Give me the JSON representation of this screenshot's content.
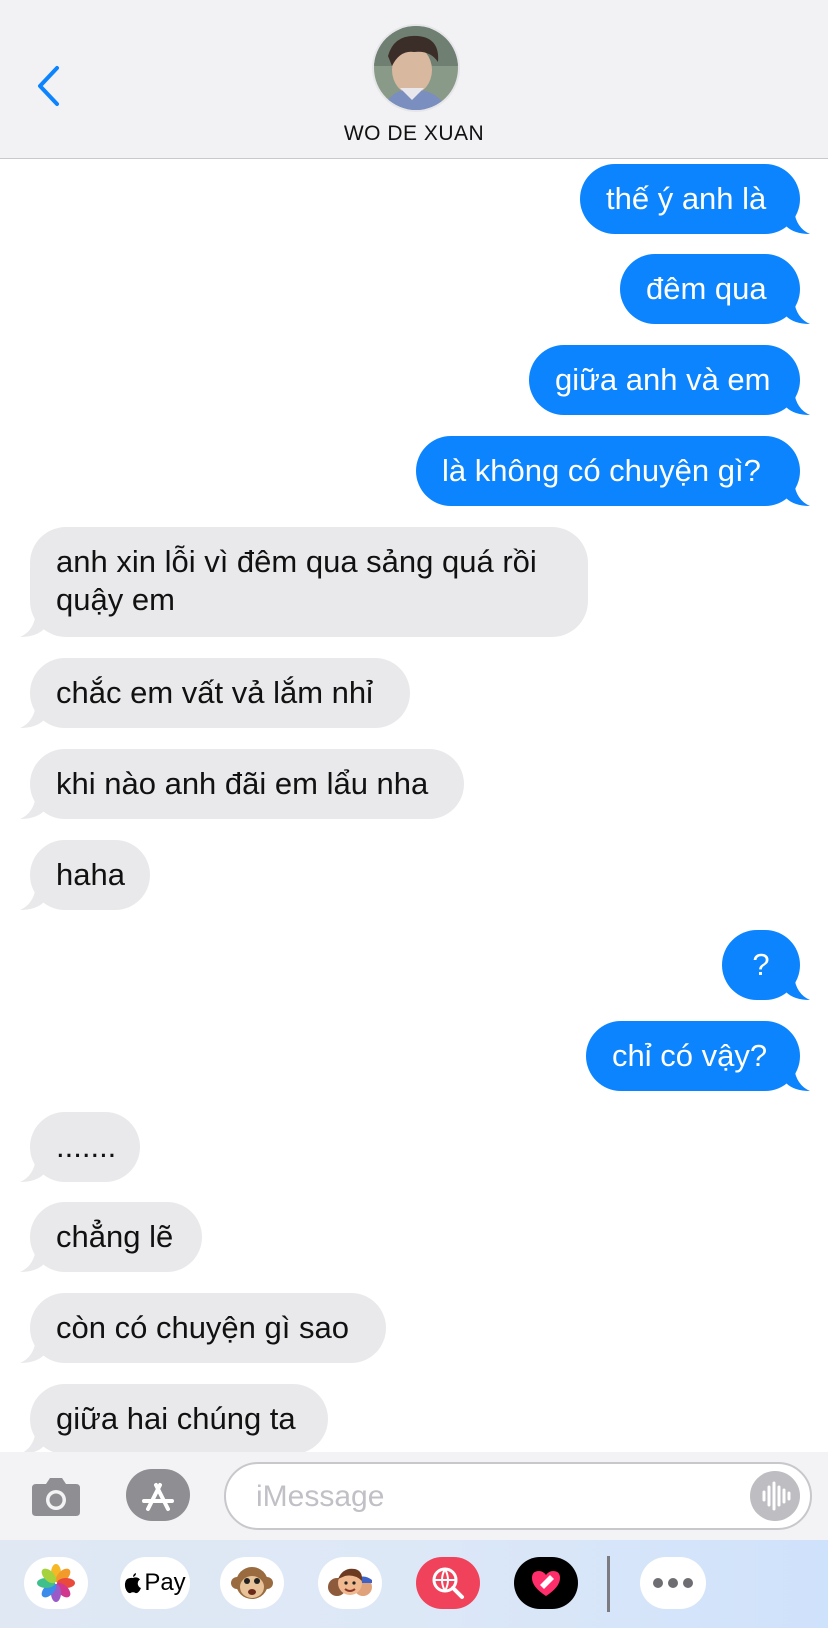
{
  "header": {
    "contact_name": "WO DE XUAN"
  },
  "messages": [
    {
      "direction": "outgoing",
      "text": "thế ý anh là"
    },
    {
      "direction": "outgoing",
      "text": "đêm qua"
    },
    {
      "direction": "outgoing",
      "text": "giữa anh và em"
    },
    {
      "direction": "outgoing",
      "text": "là không có chuyện gì?"
    },
    {
      "direction": "incoming",
      "text": "anh xin lỗi vì đêm qua sảng quá rồi quậy em"
    },
    {
      "direction": "incoming",
      "text": "chắc em vất vả lắm nhỉ"
    },
    {
      "direction": "incoming",
      "text": "khi nào anh đãi em lẩu nha"
    },
    {
      "direction": "incoming",
      "text": "haha"
    },
    {
      "direction": "outgoing",
      "text": "?"
    },
    {
      "direction": "outgoing",
      "text": "chỉ có vậy?"
    },
    {
      "direction": "incoming",
      "text": "......."
    },
    {
      "direction": "incoming",
      "text": "chẳng lẽ"
    },
    {
      "direction": "incoming",
      "text": "còn có chuyện gì sao"
    },
    {
      "direction": "incoming",
      "text": "giữa hai chúng ta"
    }
  ],
  "input_bar": {
    "placeholder": "iMessage",
    "value": ""
  },
  "app_drawer": {
    "apple_pay_label": "Pay",
    "apps": [
      "photos-icon",
      "apple-pay-icon",
      "monkey-animoji-icon",
      "memoji-icon",
      "web-search-icon",
      "digital-touch-icon",
      "more-icon"
    ]
  },
  "colors": {
    "outgoing_bubble": "#0b84fe",
    "incoming_bubble": "#e9e9eb",
    "accent": "#0b84fe"
  }
}
